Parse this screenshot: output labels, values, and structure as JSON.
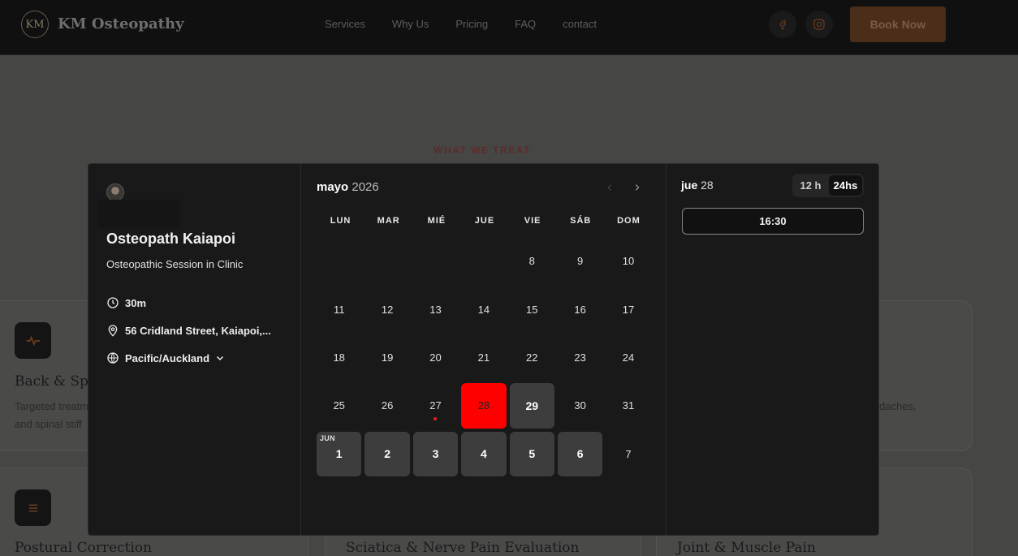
{
  "site": {
    "logo_mark": "KM",
    "brand": "KM Osteopathy",
    "nav": [
      "Services",
      "Why Us",
      "Pricing",
      "FAQ",
      "contact"
    ],
    "book_label": "Book Now",
    "section_eyebrow": "WHAT WE TREAT",
    "cards": [
      {
        "title": "Back & Spi",
        "text": [
          "Targeted treatm",
          "and spinal stiff"
        ],
        "icon": "pulse-icon"
      },
      {
        "title": "",
        "text": [
          "daches,"
        ],
        "icon": ""
      },
      {
        "title": "Postural Correction",
        "text": [],
        "icon": "lines-icon"
      },
      {
        "title": "Sciatica & Nerve Pain Evaluation",
        "text": [],
        "icon": ""
      },
      {
        "title": "Joint & Muscle Pain",
        "text": [],
        "icon": ""
      }
    ]
  },
  "booking": {
    "event_title": "Osteopath Kaiapoi",
    "event_subtitle": "Osteopathic Session in Clinic",
    "duration": "30m",
    "location": "56 Cridland Street, Kaiapoi,...",
    "timezone": "Pacific/Auckland",
    "calendar": {
      "month": "mayo",
      "year": "2026",
      "weekdays": [
        "LUN",
        "MAR",
        "MIÉ",
        "JUE",
        "VIE",
        "SÁB",
        "DOM"
      ],
      "leading_blanks": 4,
      "days": [
        {
          "label": "8"
        },
        {
          "label": "9"
        },
        {
          "label": "10"
        },
        {
          "label": "11"
        },
        {
          "label": "12"
        },
        {
          "label": "13"
        },
        {
          "label": "14"
        },
        {
          "label": "15"
        },
        {
          "label": "16"
        },
        {
          "label": "17"
        },
        {
          "label": "18"
        },
        {
          "label": "19"
        },
        {
          "label": "20"
        },
        {
          "label": "21"
        },
        {
          "label": "22"
        },
        {
          "label": "23"
        },
        {
          "label": "24"
        },
        {
          "label": "25"
        },
        {
          "label": "26"
        },
        {
          "label": "27",
          "today": true
        },
        {
          "label": "28",
          "selected": true
        },
        {
          "label": "29",
          "available": true
        },
        {
          "label": "30"
        },
        {
          "label": "31"
        },
        {
          "label": "1",
          "available": true,
          "month_tag": "JUN"
        },
        {
          "label": "2",
          "available": true
        },
        {
          "label": "3",
          "available": true
        },
        {
          "label": "4",
          "available": true
        },
        {
          "label": "5",
          "available": true
        },
        {
          "label": "6",
          "available": true
        },
        {
          "label": "7"
        }
      ]
    },
    "selected_day": {
      "weekday": "jue",
      "day": "28"
    },
    "time_format": {
      "options": [
        "12 h",
        "24hs"
      ],
      "active": "24hs"
    },
    "slots": [
      "16:30"
    ]
  },
  "colors": {
    "selected_day": "#ff0000",
    "today_dot": "#e81c1c",
    "available_day": "#3d3d3d",
    "book_button": "#4a2e1a"
  }
}
